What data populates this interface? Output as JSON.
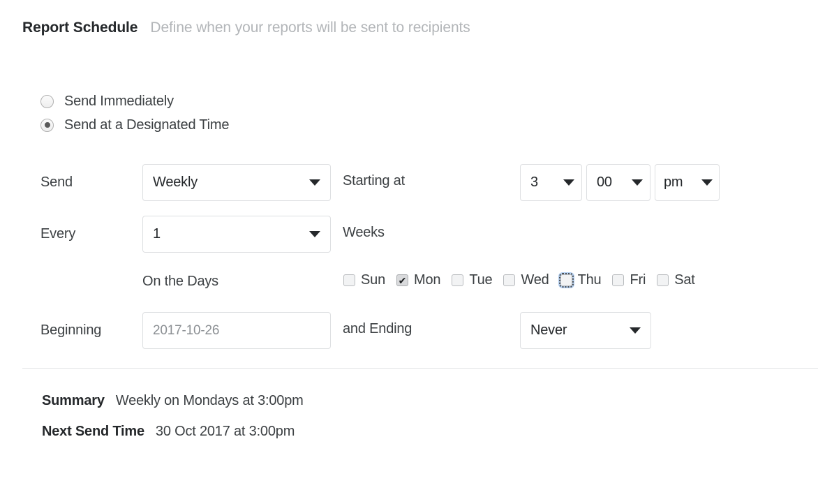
{
  "header": {
    "title": "Report Schedule",
    "subtitle": "Define when your reports will be sent to recipients"
  },
  "delivery_mode": {
    "options": [
      {
        "label": "Send Immediately",
        "selected": false
      },
      {
        "label": "Send at a Designated Time",
        "selected": true
      }
    ]
  },
  "schedule": {
    "send_label": "Send",
    "frequency_value": "Weekly",
    "starting_at_label": "Starting at",
    "time": {
      "hour": "3",
      "minute": "00",
      "meridiem": "pm"
    },
    "every_label": "Every",
    "interval_value": "1",
    "interval_unit_label": "Weeks",
    "on_the_days_label": "On the Days",
    "days": [
      {
        "label": "Sun",
        "checked": false,
        "focused": false
      },
      {
        "label": "Mon",
        "checked": true,
        "focused": false
      },
      {
        "label": "Tue",
        "checked": false,
        "focused": false
      },
      {
        "label": "Wed",
        "checked": false,
        "focused": false
      },
      {
        "label": "Thu",
        "checked": false,
        "focused": true
      },
      {
        "label": "Fri",
        "checked": false,
        "focused": false
      },
      {
        "label": "Sat",
        "checked": false,
        "focused": false
      }
    ],
    "beginning_label": "Beginning",
    "beginning_value": "",
    "beginning_placeholder": "2017-10-26",
    "and_ending_label": "and Ending",
    "ending_value": "Never"
  },
  "summary": {
    "summary_label": "Summary",
    "summary_value": "Weekly on Mondays at 3:00pm",
    "next_send_label": "Next Send Time",
    "next_send_value": "30 Oct 2017 at 3:00pm"
  },
  "icons": {
    "chevron_down": "chevron-down-icon",
    "check": "✔"
  }
}
